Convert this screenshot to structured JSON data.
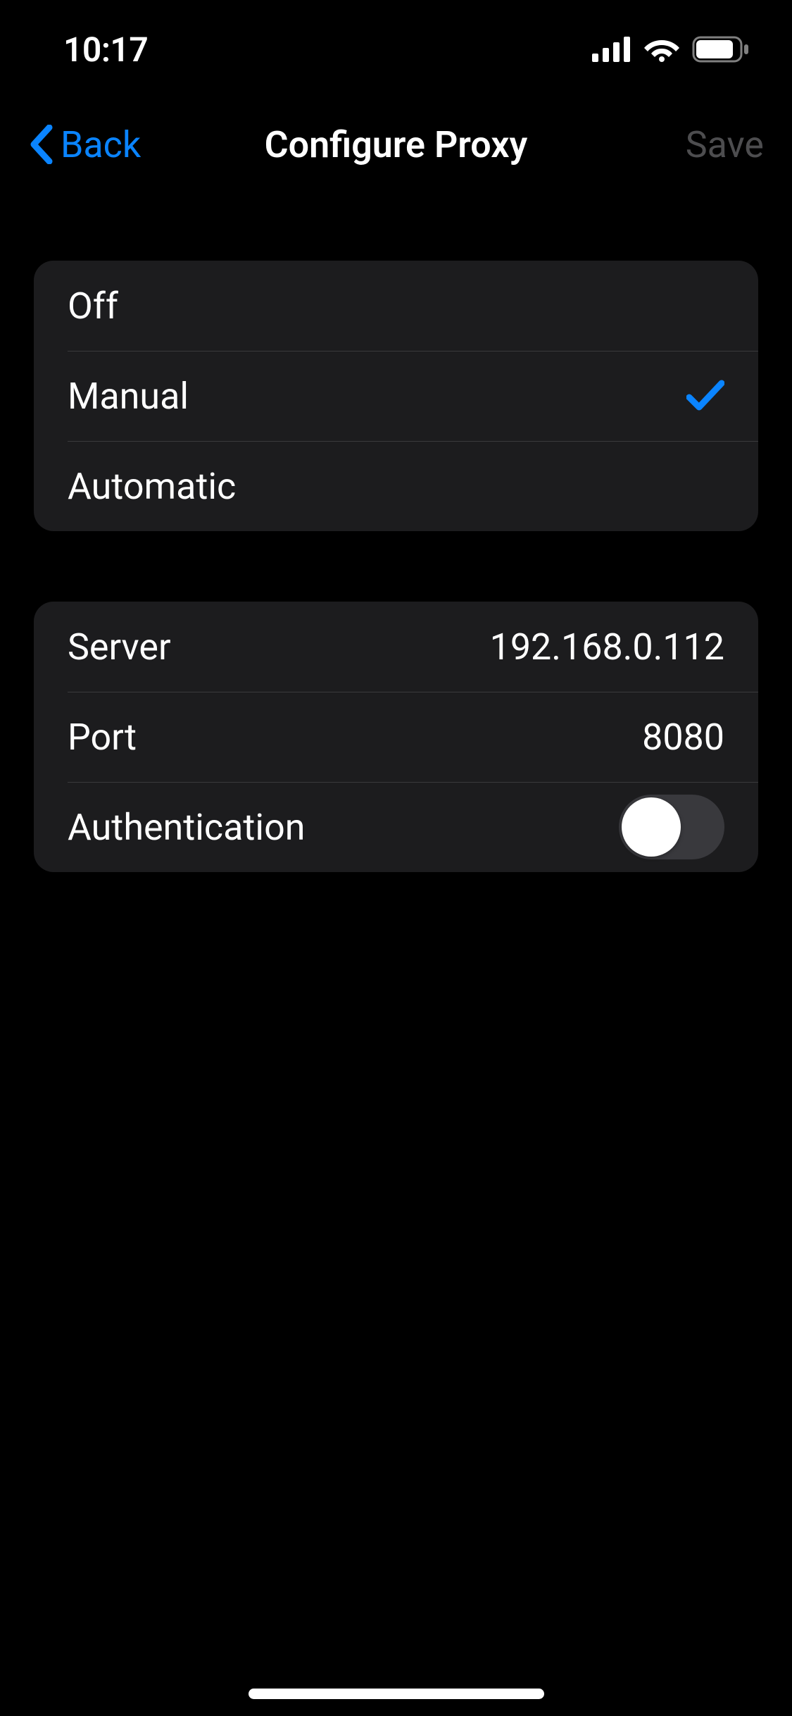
{
  "statusBar": {
    "time": "10:17"
  },
  "nav": {
    "back": "Back",
    "title": "Configure Proxy",
    "save": "Save"
  },
  "modes": {
    "items": [
      {
        "label": "Off",
        "selected": false
      },
      {
        "label": "Manual",
        "selected": true
      },
      {
        "label": "Automatic",
        "selected": false
      }
    ]
  },
  "settings": {
    "server": {
      "label": "Server",
      "value": "192.168.0.112"
    },
    "port": {
      "label": "Port",
      "value": "8080"
    },
    "authentication": {
      "label": "Authentication",
      "enabled": false
    }
  }
}
